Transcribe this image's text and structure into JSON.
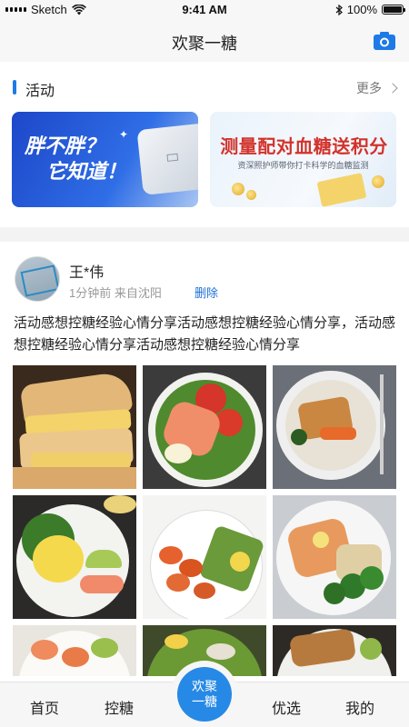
{
  "status_bar": {
    "carrier": "Sketch",
    "time": "9:41 AM",
    "battery": "100%"
  },
  "nav": {
    "title": "欢聚一糖",
    "camera_icon": "camera-icon"
  },
  "activity": {
    "title": "活动",
    "more_label": "更多",
    "banners": [
      {
        "line1": "胖不胖？",
        "line2": "它知道！"
      },
      {
        "title": "测量配对血糖送积分",
        "subtitle": "资深照护师带你打卡科学的血糖监测"
      }
    ]
  },
  "post": {
    "username": "王*伟",
    "meta": "1分钟前  来自沈阳",
    "delete_label": "删除",
    "text": "活动感想控糖经验心情分享活动感想控糖经验心情分享，活动感想控糖经验心情分享活动感想控糖经验心情分享"
  },
  "tabbar": {
    "items": [
      "首页",
      "控糖",
      "优选",
      "我的"
    ],
    "center_label_1": "欢聚",
    "center_label_2": "一糖"
  },
  "colors": {
    "accent": "#1e7ae6",
    "center_button": "#2689e6",
    "link": "#1e6fd6"
  }
}
